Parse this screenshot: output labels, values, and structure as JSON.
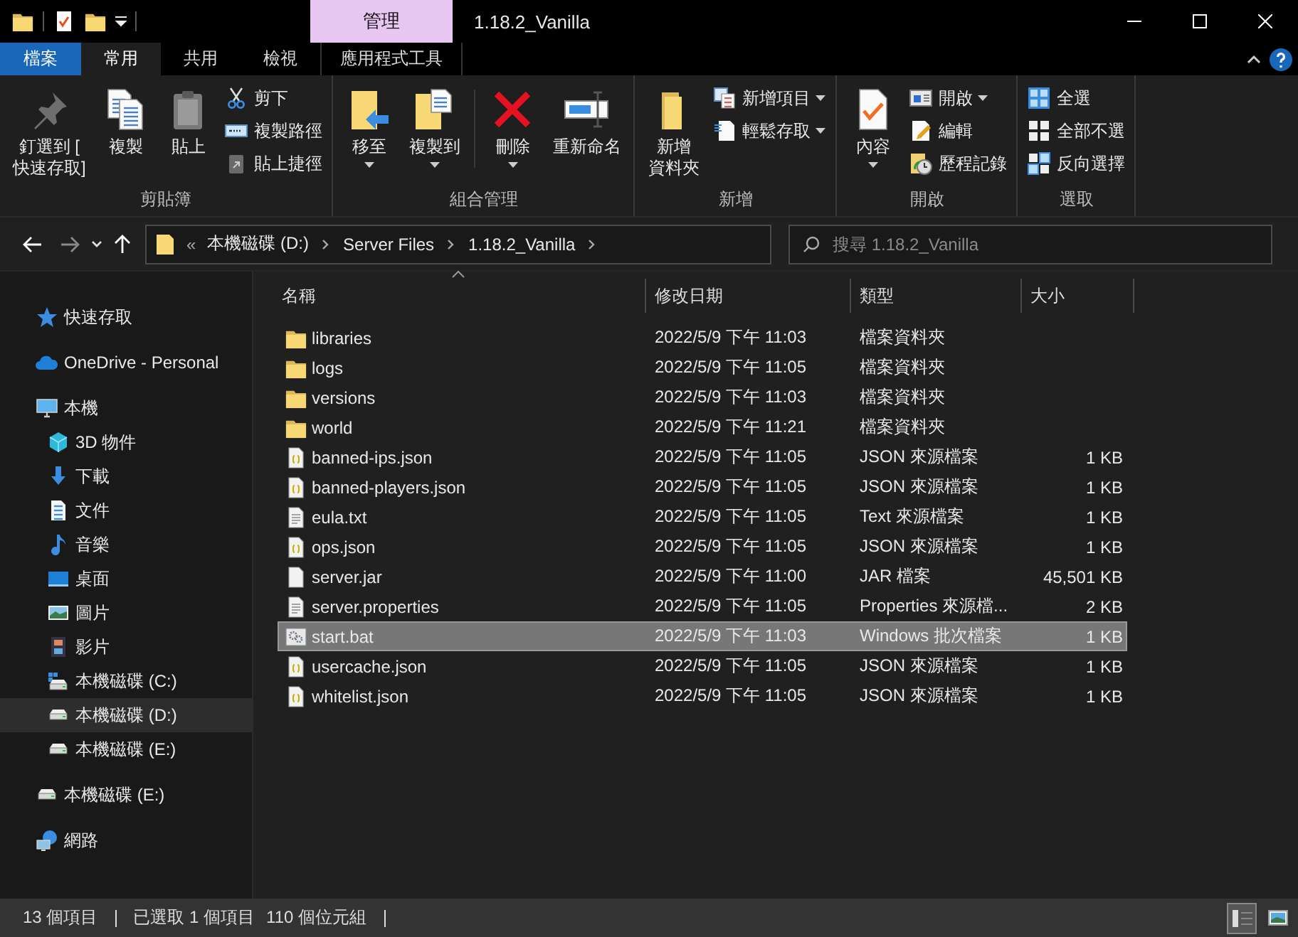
{
  "title_bar": {
    "context_tab": "管理",
    "title": "1.18.2_Vanilla"
  },
  "ribbon_tabs": [
    {
      "label": "檔案",
      "kind": "file",
      "selected": false
    },
    {
      "label": "常用",
      "kind": "normal",
      "selected": true
    },
    {
      "label": "共用",
      "kind": "normal",
      "selected": false
    },
    {
      "label": "檢視",
      "kind": "normal",
      "selected": false
    },
    {
      "label": "應用程式工具",
      "kind": "context",
      "selected": false
    }
  ],
  "ribbon_groups": [
    {
      "label": "剪貼簿",
      "items": [
        {
          "kind": "large",
          "lines": [
            "釘選到 [",
            "快速存取]"
          ],
          "dropdown": false
        },
        {
          "kind": "large",
          "lines": [
            "複製"
          ],
          "dropdown": false
        },
        {
          "kind": "large",
          "lines": [
            "貼上"
          ],
          "dropdown": false
        },
        {
          "kind": "small",
          "lines": [
            "剪下"
          ],
          "dropdown": false
        },
        {
          "kind": "small",
          "lines": [
            "複製路徑"
          ],
          "dropdown": false
        },
        {
          "kind": "small",
          "lines": [
            "貼上捷徑"
          ],
          "dropdown": false
        }
      ]
    },
    {
      "label": "組合管理",
      "items": [
        {
          "kind": "large",
          "lines": [
            "移至"
          ],
          "dropdown": true
        },
        {
          "kind": "large",
          "lines": [
            "複製到"
          ],
          "dropdown": true
        },
        {
          "kind": "separator"
        },
        {
          "kind": "large",
          "lines": [
            "刪除"
          ],
          "dropdown": true
        },
        {
          "kind": "large",
          "lines": [
            "重新命名"
          ],
          "dropdown": false
        }
      ]
    },
    {
      "label": "新增",
      "items": [
        {
          "kind": "large",
          "lines": [
            "新增",
            "資料夾"
          ],
          "dropdown": false
        },
        {
          "kind": "small",
          "lines": [
            "新增項目"
          ],
          "dropdown": true
        },
        {
          "kind": "small",
          "lines": [
            "輕鬆存取"
          ],
          "dropdown": true
        }
      ]
    },
    {
      "label": "開啟",
      "items": [
        {
          "kind": "large",
          "lines": [
            "內容"
          ],
          "dropdown": true
        },
        {
          "kind": "small",
          "lines": [
            "開啟"
          ],
          "dropdown": true
        },
        {
          "kind": "small",
          "lines": [
            "編輯"
          ],
          "dropdown": false
        },
        {
          "kind": "small",
          "lines": [
            "歷程記錄"
          ],
          "dropdown": false
        }
      ]
    },
    {
      "label": "選取",
      "items": [
        {
          "kind": "small",
          "lines": [
            "全選"
          ],
          "dropdown": false
        },
        {
          "kind": "small",
          "lines": [
            "全部不選"
          ],
          "dropdown": false
        },
        {
          "kind": "small",
          "lines": [
            "反向選擇"
          ],
          "dropdown": false
        }
      ]
    }
  ],
  "address_bar": {
    "overflow": "«",
    "crumbs": [
      "本機磁碟 (D:)",
      "Server Files",
      "1.18.2_Vanilla"
    ]
  },
  "search": {
    "placeholder": "搜尋 1.18.2_Vanilla"
  },
  "sidebar": {
    "items": [
      {
        "label": "快速存取",
        "selected": false
      },
      {
        "label": "OneDrive - Personal",
        "selected": false
      },
      {
        "label": "本機",
        "selected": false,
        "children": [
          {
            "label": "3D 物件",
            "selected": false
          },
          {
            "label": "下載",
            "selected": false
          },
          {
            "label": "文件",
            "selected": false
          },
          {
            "label": "音樂",
            "selected": false
          },
          {
            "label": "桌面",
            "selected": false
          },
          {
            "label": "圖片",
            "selected": false
          },
          {
            "label": "影片",
            "selected": false
          },
          {
            "label": "本機磁碟 (C:)",
            "selected": false
          },
          {
            "label": "本機磁碟 (D:)",
            "selected": true
          },
          {
            "label": "本機磁碟 (E:)",
            "selected": false
          }
        ]
      },
      {
        "label": "本機磁碟 (E:)",
        "selected": false
      },
      {
        "label": "網路",
        "selected": false
      }
    ]
  },
  "file_list": {
    "columns": [
      "名稱",
      "修改日期",
      "類型",
      "大小"
    ],
    "rows": [
      {
        "name": "libraries",
        "kind": "folder",
        "date": "2022/5/9 下午 11:03",
        "type": "檔案資料夾",
        "selected": false
      },
      {
        "name": "logs",
        "kind": "folder",
        "date": "2022/5/9 下午 11:05",
        "type": "檔案資料夾",
        "selected": false
      },
      {
        "name": "versions",
        "kind": "folder",
        "date": "2022/5/9 下午 11:03",
        "type": "檔案資料夾",
        "selected": false
      },
      {
        "name": "world",
        "kind": "folder",
        "date": "2022/5/9 下午 11:21",
        "type": "檔案資料夾",
        "selected": false
      },
      {
        "name": "banned-ips.json",
        "kind": "json",
        "date": "2022/5/9 下午 11:05",
        "type": "JSON 來源檔案",
        "size": "1 KB",
        "selected": false
      },
      {
        "name": "banned-players.json",
        "kind": "json",
        "date": "2022/5/9 下午 11:05",
        "type": "JSON 來源檔案",
        "size": "1 KB",
        "selected": false
      },
      {
        "name": "eula.txt",
        "kind": "text",
        "date": "2022/5/9 下午 11:05",
        "type": "Text 來源檔案",
        "size": "1 KB",
        "selected": false
      },
      {
        "name": "ops.json",
        "kind": "json",
        "date": "2022/5/9 下午 11:05",
        "type": "JSON 來源檔案",
        "size": "1 KB",
        "selected": false
      },
      {
        "name": "server.jar",
        "kind": "blank",
        "date": "2022/5/9 下午 11:00",
        "type": "JAR 檔案",
        "size": "45,501 KB",
        "selected": false
      },
      {
        "name": "server.properties",
        "kind": "text",
        "date": "2022/5/9 下午 11:05",
        "type": "Properties 來源檔...",
        "size": "2 KB",
        "selected": false
      },
      {
        "name": "start.bat",
        "kind": "batch",
        "date": "2022/5/9 下午 11:03",
        "type": "Windows 批次檔案",
        "size": "1 KB",
        "selected": true
      },
      {
        "name": "usercache.json",
        "kind": "json",
        "date": "2022/5/9 下午 11:05",
        "type": "JSON 來源檔案",
        "size": "1 KB",
        "selected": false
      },
      {
        "name": "whitelist.json",
        "kind": "json",
        "date": "2022/5/9 下午 11:05",
        "type": "JSON 來源檔案",
        "size": "1 KB",
        "selected": false
      }
    ]
  },
  "status_bar": {
    "texts": [
      "13 個項目",
      "已選取 1 個項目",
      "110 個位元組"
    ],
    "views": [
      {
        "kind": "details",
        "selected": true
      },
      {
        "kind": "large_icons",
        "selected": false
      }
    ]
  }
}
